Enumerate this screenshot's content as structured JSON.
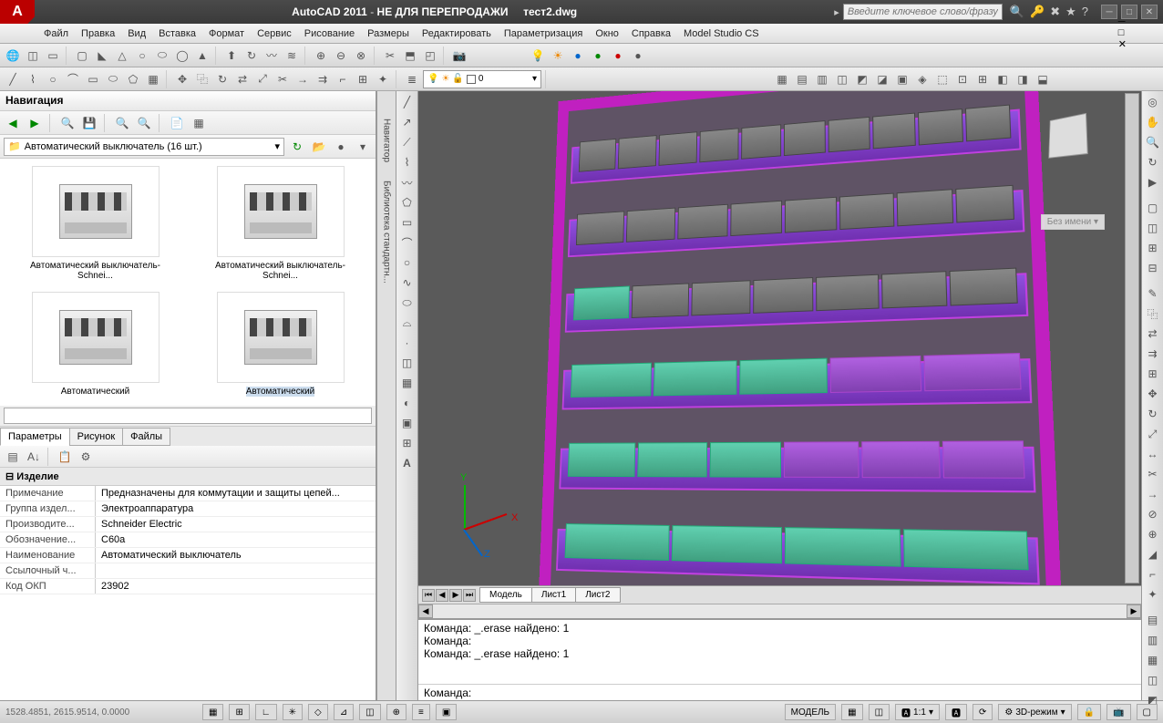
{
  "title": {
    "app": "AutoCAD 2011",
    "note": "НЕ ДЛЯ ПЕРЕПРОДАЖИ",
    "file": "тест2.dwg"
  },
  "search_placeholder": "Введите ключевое слово/фразу",
  "menu": [
    "Файл",
    "Правка",
    "Вид",
    "Вставка",
    "Формат",
    "Сервис",
    "Рисование",
    "Размеры",
    "Редактировать",
    "Параметризация",
    "Окно",
    "Справка",
    "Model Studio CS"
  ],
  "nav": {
    "title": "Навигация",
    "path": "Автоматический выключатель (16 шт.)",
    "items": [
      {
        "label": "Автоматический выключатель-Schnei..."
      },
      {
        "label": "Автоматический выключатель-Schnei..."
      },
      {
        "label": "Автоматический"
      },
      {
        "label": "Автоматический",
        "selected": true
      }
    ]
  },
  "side_tabs": {
    "navigator": "Навигатор",
    "library": "Библиотека стандартн..."
  },
  "tabs": {
    "params": "Параметры",
    "image": "Рисунок",
    "files": "Файлы"
  },
  "props": {
    "section": "Изделие",
    "rows": [
      {
        "k": "Примечание",
        "v": "Предназначены для коммутации и защиты цепей..."
      },
      {
        "k": "Группа издел...",
        "v": "Электроаппаратура"
      },
      {
        "k": "Производите...",
        "v": "Schneider Electric"
      },
      {
        "k": "Обозначение...",
        "v": "C60a"
      },
      {
        "k": "Наименование",
        "v": "Автоматический выключатель"
      },
      {
        "k": "Ссылочный ч...",
        "v": ""
      },
      {
        "k": "Код ОКП",
        "v": "23902"
      }
    ]
  },
  "axis": {
    "x": "X",
    "y": "Y",
    "z": "Z"
  },
  "viewcube_noname": "Без имени ▾",
  "vp_tabs": [
    "Модель",
    "Лист1",
    "Лист2"
  ],
  "cmd_lines": [
    "Команда: _.erase найдено: 1",
    "Команда:",
    "Команда: _.erase найдено: 1"
  ],
  "cmd_prompt": "Команда:",
  "layer_value": "0",
  "status": {
    "coords": "1528.4851, 2615.9514, 0.0000",
    "model": "МОДЕЛЬ",
    "scale": "1:1",
    "mode3d": "3D-режим"
  }
}
